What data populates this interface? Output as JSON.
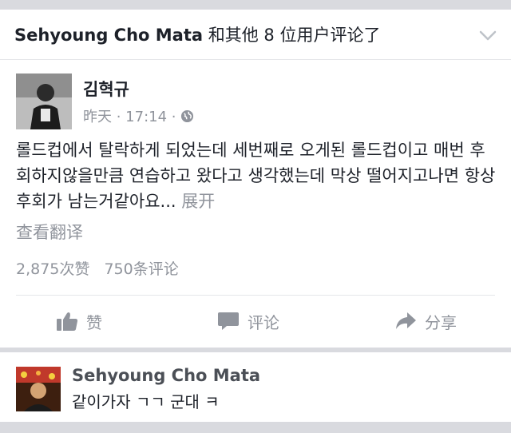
{
  "notification": {
    "actor": "Sehyoung Cho Mata",
    "action": " 和其他 8 位用户评论了"
  },
  "post": {
    "author": "김혁규",
    "time": "昨天 · 17:14 ·",
    "text": "롤드컵에서 탈락하게 되었는데 세번째로 오게된 롤드컵이고 매번 후회하지않을만큼 연습하고 왔다고 생각했는데 막상 떨어지고나면 항상 후회가 남는거같아요...",
    "more_label": "展开",
    "translate_label": "查看翻译",
    "likes": "2,875次赞",
    "comments": "750条评论"
  },
  "actions": {
    "like": "赞",
    "comment": "评论",
    "share": "分享"
  },
  "comment": {
    "author": "Sehyoung Cho Mata",
    "text": "같이가자 ㄱㄱ 군대 ㅋ"
  },
  "colors": {
    "background": "#d9dadf",
    "card": "#ffffff",
    "secondary_text": "#90949c",
    "primary_text": "#1d2129",
    "icon_gray": "#90949c"
  },
  "icons": {
    "chevron": "chevron-down-icon",
    "globe": "globe-icon",
    "like": "thumbs-up-icon",
    "comment": "comment-bubble-icon",
    "share": "share-arrow-icon"
  }
}
